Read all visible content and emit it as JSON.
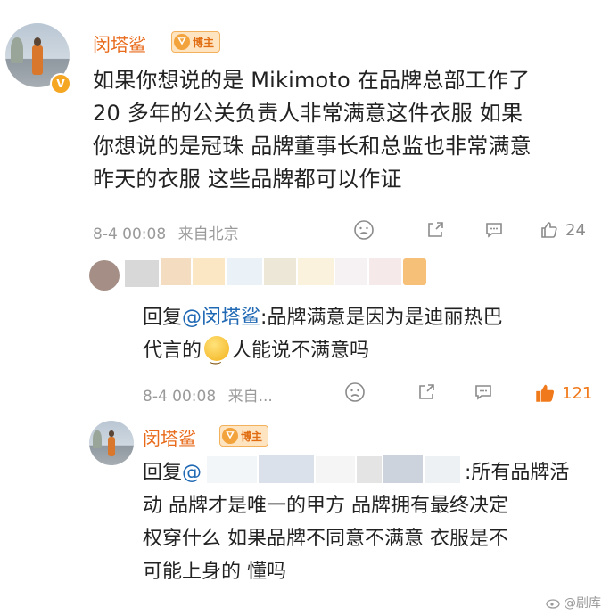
{
  "post": {
    "author": "闵塔鲨",
    "badge": "博主",
    "verified": "V",
    "lines": [
      "如果你想说的是 Mikimoto 在品牌总部工作了",
      "20 多年的公关负责人非常满意这件衣服 如果",
      "你想说的是冠珠 品牌董事长和总监也非常满意",
      "昨天的衣服 这些品牌都可以作证"
    ],
    "time": "8-4 00:08",
    "source": "来自北京",
    "likes": "24"
  },
  "reply1": {
    "prefix": "回复",
    "mention": "@闵塔鲨",
    "line1": ":品牌满意是因为是迪丽热巴",
    "line2_before": "代言的",
    "line2_after": "人能说不满意吗",
    "time": "8-4 00:08",
    "source": "来自...",
    "likes": "121"
  },
  "reply2": {
    "author": "闵塔鲨",
    "badge": "博主",
    "prefix": "回复",
    "mention_at": "@",
    "line1_after": ":所有品牌活",
    "line2": "动 品牌才是唯一的甲方 品牌拥有最终决定",
    "line3": "权穿什么 如果品牌不同意不满意 衣服是不",
    "line4": "可能上身的 懂吗"
  },
  "watermark": "@剧库",
  "colors": {
    "username": "#e86a1a",
    "mention": "#1f68b3",
    "like_active": "#f07a1b",
    "meta": "#9a9a9a"
  }
}
